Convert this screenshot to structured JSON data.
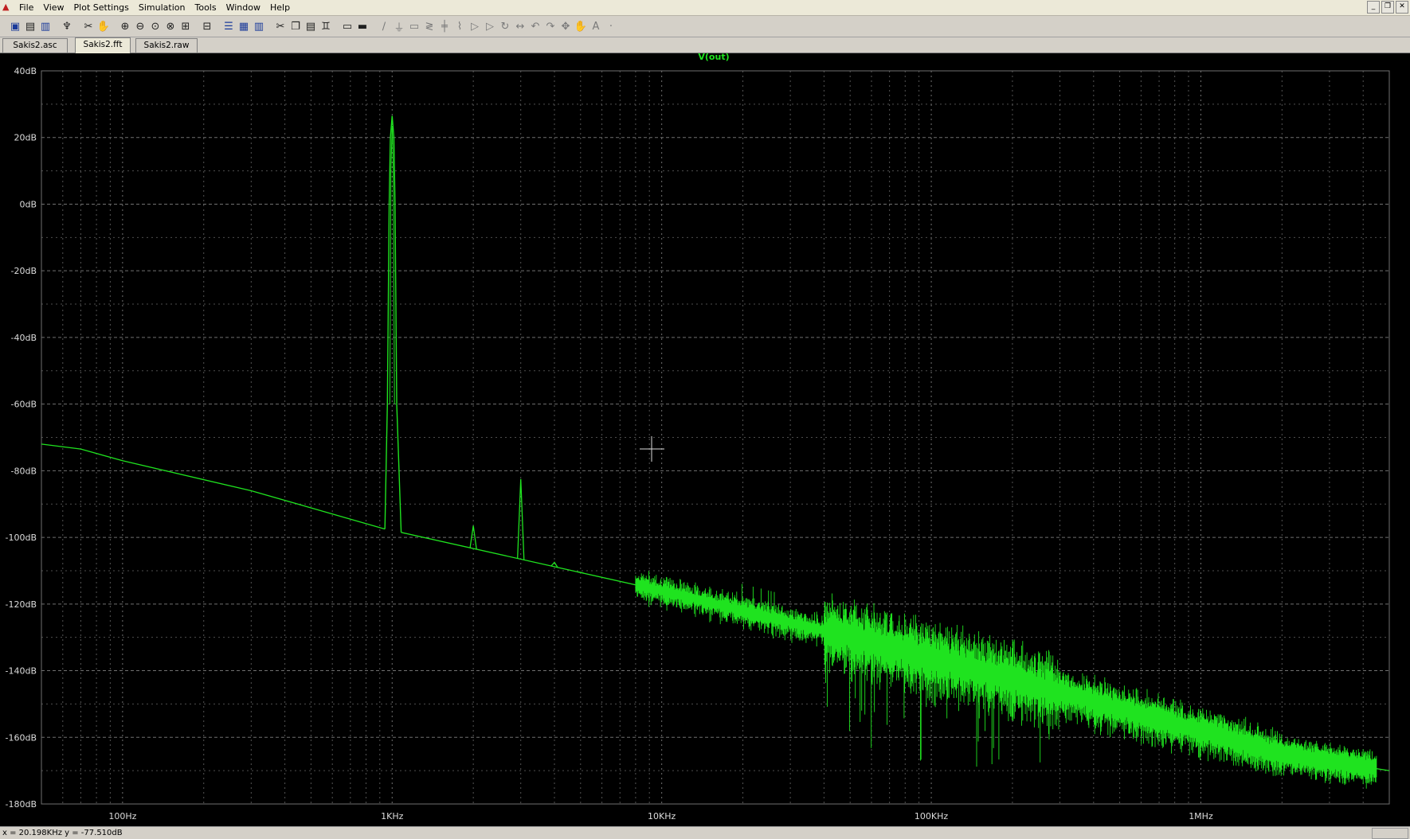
{
  "window": {
    "menu": [
      "File",
      "View",
      "Plot Settings",
      "Simulation",
      "Tools",
      "Window",
      "Help"
    ],
    "controls": [
      "minimize-icon",
      "restore-icon",
      "close-icon"
    ]
  },
  "toolbar": {
    "icons": [
      "new-schematic-icon",
      "open-icon",
      "save-icon",
      "control-panel-icon",
      "run-icon",
      "pan-icon",
      "zoom-in-icon",
      "zoom-out-icon",
      "zoom-fit-icon",
      "zoom-cancel-icon",
      "autorange-icon",
      "fft-icon",
      "tile-horizontal-icon",
      "cascade-icon",
      "tile-vertical-icon",
      "cut-icon",
      "copy-icon",
      "paste-icon",
      "find-icon",
      "print-preview-icon",
      "print-icon",
      "wire-icon",
      "ground-icon",
      "label-icon",
      "resistor-icon",
      "capacitor-icon",
      "inductor-icon",
      "diode-icon",
      "component-icon",
      "rotate-icon",
      "mirror-icon",
      "undo-icon",
      "redo-icon",
      "move-icon",
      "drag-icon",
      "text-icon",
      "spice-directive-icon"
    ]
  },
  "tabs": [
    {
      "label": "Sakis2.asc",
      "active": false
    },
    {
      "label": "Sakis2.fft",
      "active": true
    },
    {
      "label": "Sakis2.raw",
      "active": false
    }
  ],
  "status": {
    "readout": "x = 20.198KHz   y = -77.510dB"
  },
  "colors": {
    "trace": "#1fe31f",
    "background": "#000000",
    "grid": "#707070",
    "axis_text": "#dcdcdc"
  },
  "chart_data": {
    "type": "line",
    "title": "V(out)",
    "xscale": "log",
    "xlim": [
      50,
      5000000
    ],
    "ylim": [
      -180,
      40
    ],
    "yticks": [
      "40dB",
      "20dB",
      "0dB",
      "-20dB",
      "-40dB",
      "-60dB",
      "-80dB",
      "-100dB",
      "-120dB",
      "-140dB",
      "-160dB",
      "-180dB"
    ],
    "xticks": [
      {
        "value": 100,
        "label": "100Hz"
      },
      {
        "value": 1000,
        "label": "1KHz"
      },
      {
        "value": 10000,
        "label": "10KHz"
      },
      {
        "value": 100000,
        "label": "100KHz"
      },
      {
        "value": 1000000,
        "label": "1MHz"
      }
    ],
    "grid": true,
    "series": [
      {
        "name": "V(out)",
        "baseline": [
          [
            50,
            -72
          ],
          [
            70,
            -73.5
          ],
          [
            100,
            -77
          ],
          [
            300,
            -86
          ],
          [
            940,
            -97.5
          ],
          [
            1080,
            -98.5
          ],
          [
            10000,
            -116
          ],
          [
            100000,
            -136
          ],
          [
            1000000,
            -158
          ],
          [
            2000000,
            -165
          ],
          [
            5000000,
            -170
          ]
        ],
        "peaks": [
          {
            "x": 1000,
            "y": 26.5
          },
          {
            "x": 2000,
            "y": -96.5
          },
          {
            "x": 3000,
            "y": -82.5
          },
          {
            "x": 4000,
            "y": -107.5
          },
          {
            "x": 5000,
            "y": -110.5
          },
          {
            "x": 18000,
            "y": -118.5
          }
        ]
      }
    ]
  }
}
